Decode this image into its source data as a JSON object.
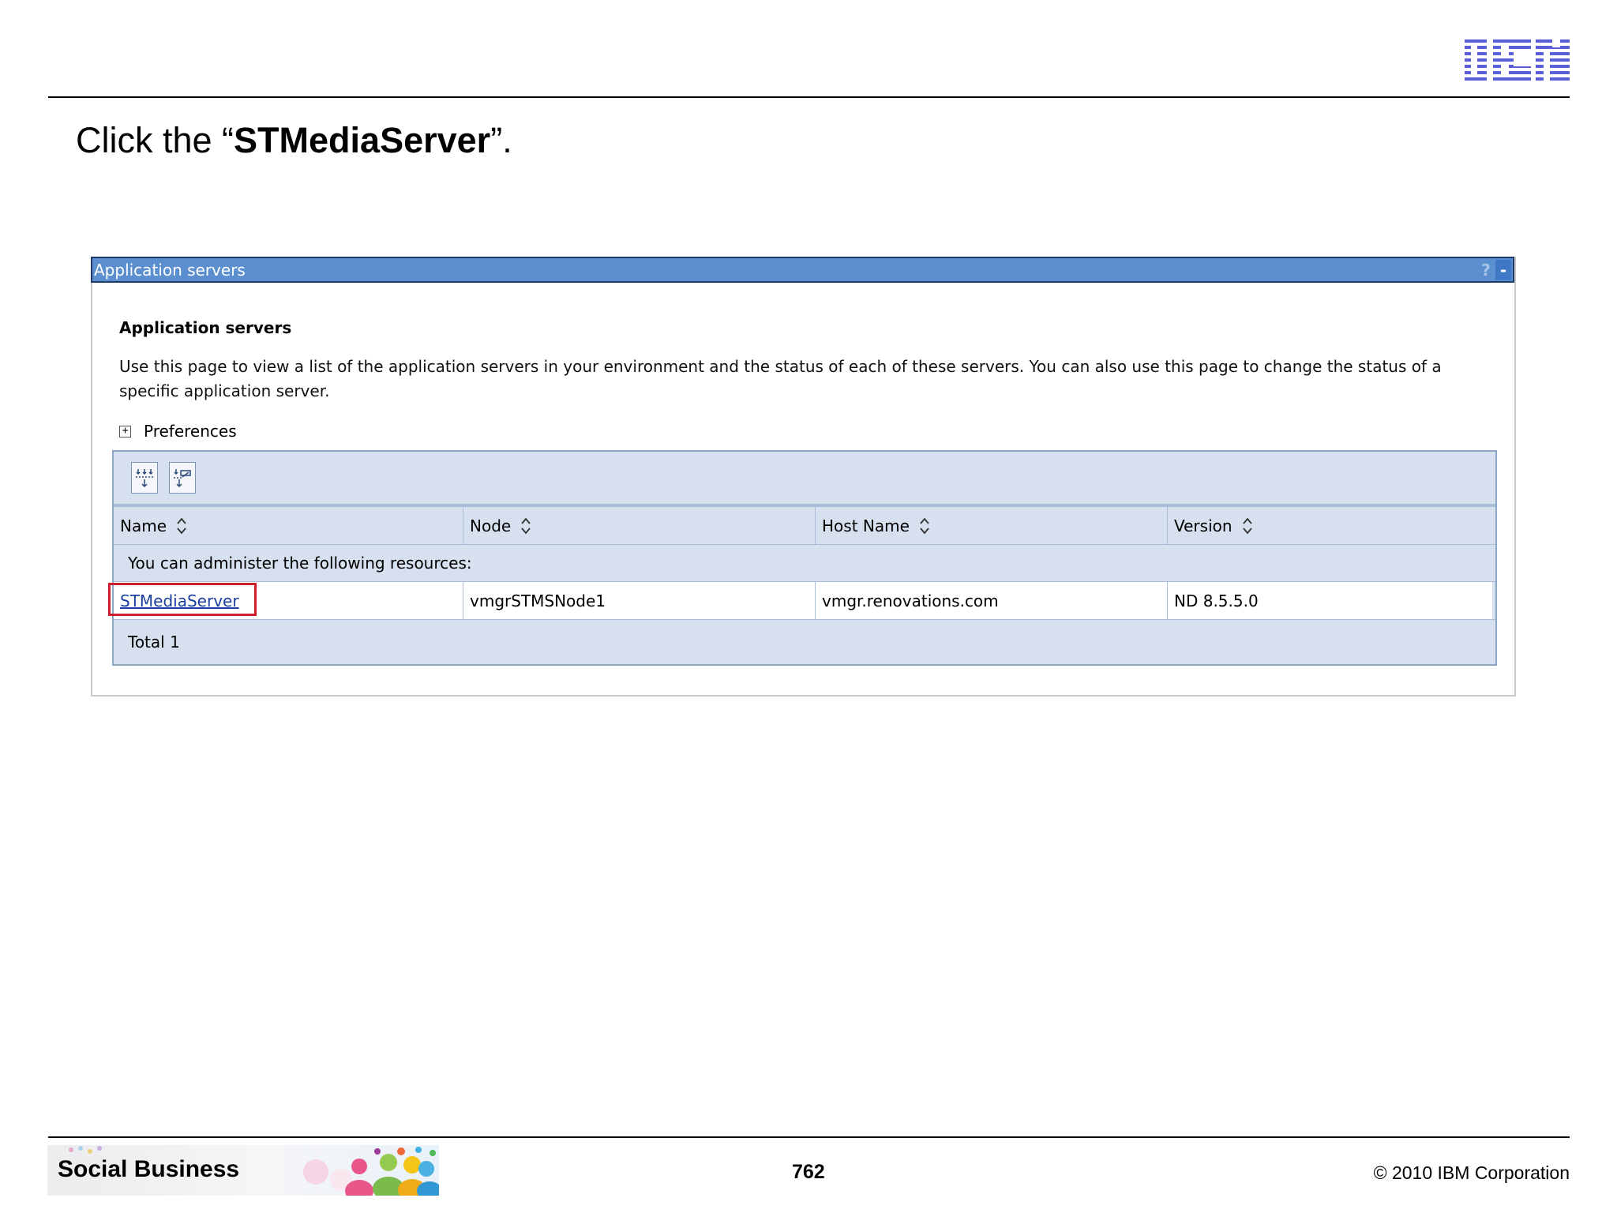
{
  "header": {
    "logo_text": "IBM",
    "brand_color": "#5a5fd6"
  },
  "slide": {
    "instruction_prefix": "Click the “",
    "instruction_bold": "STMediaServer",
    "instruction_suffix": "”."
  },
  "panel": {
    "bar_title": "Application servers",
    "help_label": "?",
    "minimize_label": "-",
    "section_title": "Application servers",
    "description": "Use this page to view a list of the application servers in your environment and the status of each of these servers. You can also use this page to change the status of a specific application server.",
    "preferences_label": "Preferences",
    "toolbar": {
      "buttons": [
        "select-all-icon",
        "deselect-all-icon"
      ]
    },
    "table": {
      "columns": [
        "Name",
        "Node",
        "Host Name",
        "Version"
      ],
      "notice": "You can administer the following resources:",
      "rows": [
        {
          "name": "STMediaServer",
          "node": "vmgrSTMSNode1",
          "host": "vmgr.renovations.com",
          "version": "ND 8.5.5.0"
        }
      ],
      "total": "Total 1"
    },
    "highlight_color": "#cc1f2b"
  },
  "footer": {
    "banner_text": "Social Business",
    "page_number": "762",
    "copyright": "© 2010 IBM Corporation"
  }
}
